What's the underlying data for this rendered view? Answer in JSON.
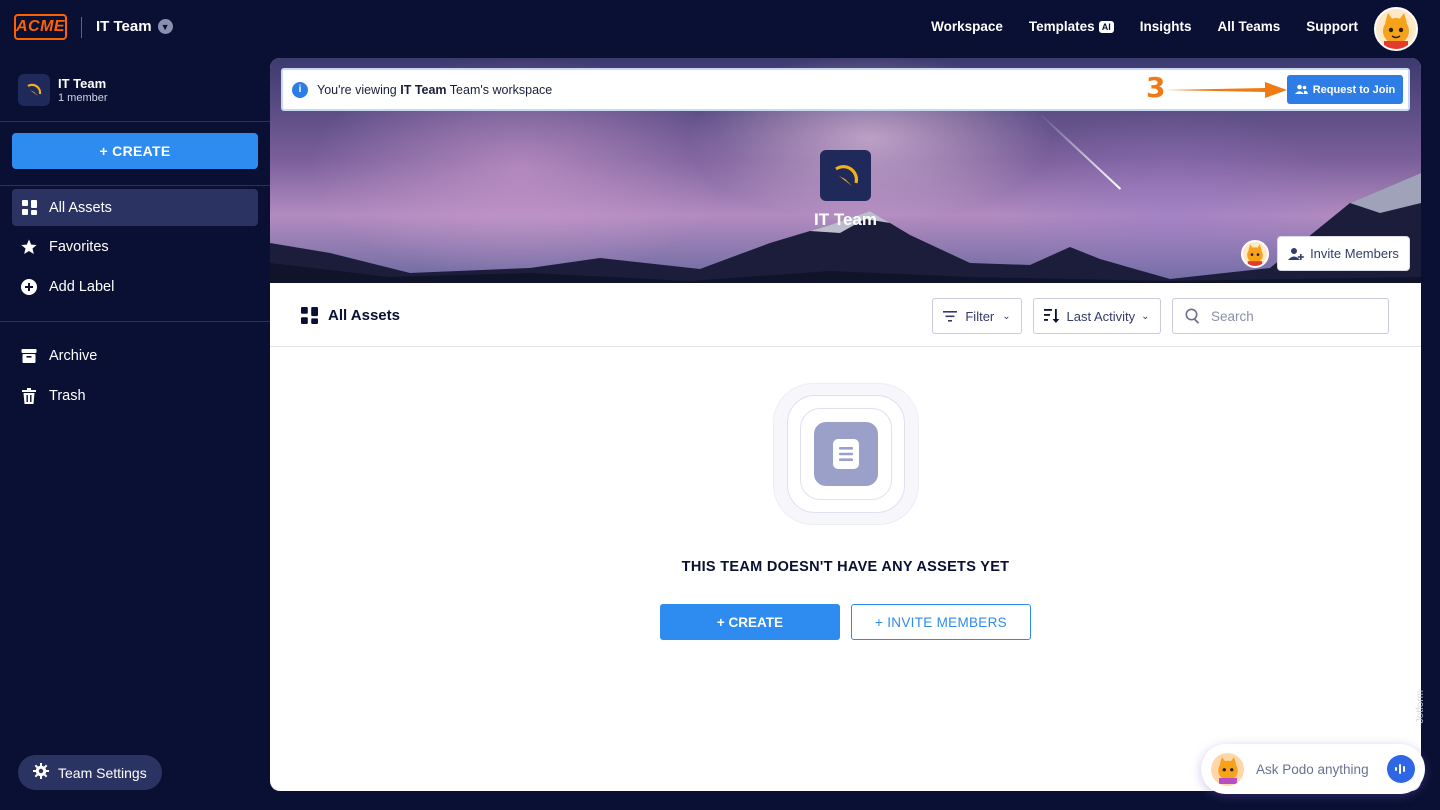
{
  "header": {
    "logo_text": "ACME",
    "team_name": "IT Team",
    "nav": [
      "Workspace",
      "Templates",
      "Insights",
      "All Teams",
      "Support"
    ],
    "templates_badge": "AI"
  },
  "sidebar": {
    "team_name": "IT Team",
    "team_members": "1 member",
    "create_label": "+ CREATE",
    "items": [
      {
        "label": "All Assets",
        "icon": "grid-icon",
        "active": true
      },
      {
        "label": "Favorites",
        "icon": "star-icon"
      },
      {
        "label": "Add Label",
        "icon": "plus-circle-icon"
      }
    ],
    "items2": [
      {
        "label": "Archive",
        "icon": "archive-icon"
      },
      {
        "label": "Trash",
        "icon": "trash-icon"
      }
    ],
    "settings_label": "Team Settings"
  },
  "notice": {
    "prefix": "You're viewing ",
    "team": "IT Team",
    "suffix": " Team's workspace",
    "request_label": "Request to Join",
    "step_number": "3"
  },
  "hero": {
    "team_name": "IT Team",
    "invite_label": "Invite Members"
  },
  "toolbar": {
    "title": "All Assets",
    "filter_label": "Filter",
    "sort_label": "Last Activity",
    "search_placeholder": "Search"
  },
  "empty": {
    "title": "THIS TEAM DOESN'T HAVE ANY ASSETS YET",
    "create_label": "+ CREATE",
    "invite_label": "+ INVITE MEMBERS"
  },
  "podo": {
    "placeholder": "Ask Podo anything"
  },
  "side_text": "Jotform",
  "colors": {
    "background": "#0a1033",
    "accent": "#2e8bef",
    "brand_orange": "#ff6100"
  }
}
